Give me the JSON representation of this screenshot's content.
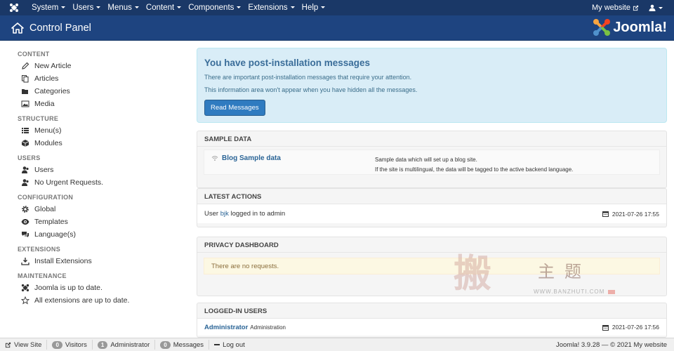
{
  "topnav": {
    "menus": [
      {
        "label": "System"
      },
      {
        "label": "Users"
      },
      {
        "label": "Menus"
      },
      {
        "label": "Content"
      },
      {
        "label": "Components"
      },
      {
        "label": "Extensions"
      },
      {
        "label": "Help"
      }
    ],
    "site_link": "My website"
  },
  "header": {
    "title": "Control Panel",
    "brand": "Joomla!",
    "brand_color": "#ffffff"
  },
  "sidebar": {
    "content_heading": "CONTENT",
    "content_items": [
      "New Article",
      "Articles",
      "Categories",
      "Media"
    ],
    "structure_heading": "STRUCTURE",
    "structure_items": [
      "Menu(s)",
      "Modules"
    ],
    "users_heading": "USERS",
    "users_items": [
      "Users",
      "No Urgent Requests."
    ],
    "configuration_heading": "CONFIGURATION",
    "configuration_items": [
      "Global",
      "Templates",
      "Language(s)"
    ],
    "extensions_heading": "EXTENSIONS",
    "extensions_items": [
      "Install Extensions"
    ],
    "maintenance_heading": "MAINTENANCE",
    "maintenance_items": [
      "Joomla is up to date.",
      "All extensions are up to date."
    ]
  },
  "alert": {
    "title": "You have post-installation messages",
    "line1": "There are important post-installation messages that require your attention.",
    "line2": "This information area won't appear when you have hidden all the messages.",
    "button": "Read Messages"
  },
  "sample_data": {
    "heading": "SAMPLE DATA",
    "name": "Blog Sample data",
    "desc1": "Sample data which will set up a blog site.",
    "desc2": "If the site is multilingual, the data will be tagged to the active backend language."
  },
  "latest_actions": {
    "heading": "LATEST ACTIONS",
    "prefix": "User ",
    "user": "bjk",
    "suffix": " logged in to admin",
    "date": "2021-07-26 17:55"
  },
  "privacy": {
    "heading": "PRIVACY DASHBOARD",
    "notice": "There are no requests."
  },
  "logged_in": {
    "heading": "LOGGED-IN USERS",
    "user": "Administrator",
    "role": "Administration",
    "date": "2021-07-26 17:56"
  },
  "watermark": {
    "big": "搬",
    "text": "主题",
    "url": "WWW.BANZHUTI.COM"
  },
  "footer": {
    "view_site": "View Site",
    "visitors_count": "0",
    "visitors": "Visitors",
    "admin_count": "1",
    "admin": "Administrator",
    "messages_count": "0",
    "messages": "Messages",
    "logout": "Log out",
    "credit": "Joomla! 3.9.28 — © 2021 My website"
  }
}
